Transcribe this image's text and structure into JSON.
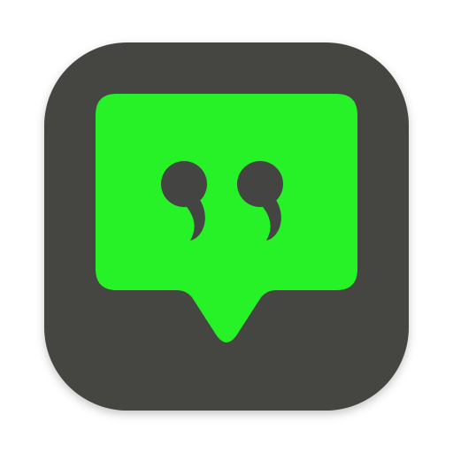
{
  "app_icon": {
    "icon_name": "quote-speech-bubble-icon",
    "colors": {
      "tile": "#444443",
      "bubble": "#27f227",
      "quote_marks": "#444443",
      "background": "#ffffff"
    }
  }
}
